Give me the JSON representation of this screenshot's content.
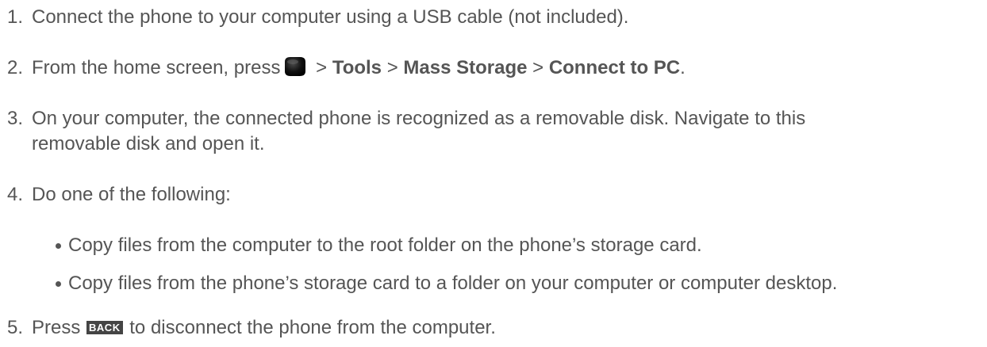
{
  "steps": [
    {
      "number": "1.",
      "text": "Connect the phone to your computer using a USB cable (not included)."
    },
    {
      "number": "2.",
      "before": "From the home screen, press",
      "icon": "home-key-icon",
      "sep1": " > ",
      "b1": "Tools",
      "sep2": " > ",
      "b2": "Mass Storage",
      "sep3": " > ",
      "b3": "Connect to PC",
      "end": "."
    },
    {
      "number": "3.",
      "line1": "On your computer, the connected phone is recognized as a removable disk. Navigate to this",
      "line2": "removable disk and open it."
    },
    {
      "number": "4.",
      "text": "Do one of the following:",
      "bullets": [
        "Copy files from the computer to the root folder on the phone’s storage card.",
        "Copy files from the phone’s storage card to a folder on your computer or computer desktop."
      ]
    },
    {
      "number": "5.",
      "before": "Press",
      "key_label": "BACK",
      "after": "to disconnect the phone from the computer."
    }
  ]
}
